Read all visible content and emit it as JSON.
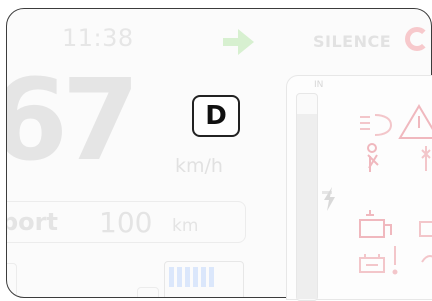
{
  "status_bar": {
    "time": "11:38",
    "brand": "SILENCE",
    "direction_icon": "arrow-right-icon"
  },
  "speedometer": {
    "speed": "67",
    "unit": "km/h"
  },
  "gear": {
    "value": "D"
  },
  "range": {
    "mode": "port",
    "value": "100",
    "unit": "km"
  },
  "gauge": {
    "label": "IN"
  },
  "warnings": [
    {
      "icon": "low-beam-icon"
    },
    {
      "icon": "seatbelt-icon"
    },
    {
      "icon": "oil-icon"
    },
    {
      "icon": "battery-warning-icon"
    },
    {
      "icon": "triangle-warning-icon"
    }
  ],
  "colors": {
    "accent_green": "#d7f0d0",
    "warning_red": "#f2b9be",
    "inactive_text": "#e4e4e4",
    "battery_blue": "#dbe7fb"
  }
}
